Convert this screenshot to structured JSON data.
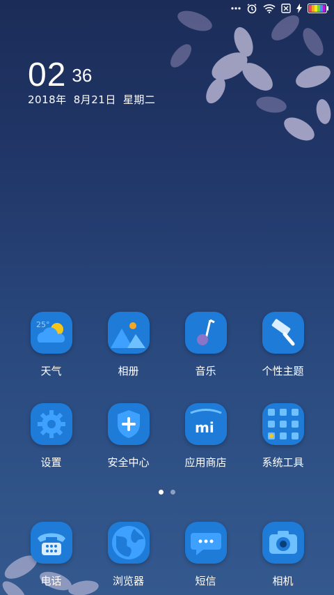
{
  "status_bar": {
    "icons": [
      "more-dots-icon",
      "alarm-icon",
      "wifi-icon",
      "no-sim-icon",
      "charging-icon",
      "battery-icon"
    ]
  },
  "lock_clock": {
    "hour": "02",
    "minute": "36",
    "year": "2018年",
    "day": "8月21日",
    "weekday": "星期二"
  },
  "apps_row1": [
    {
      "label": "天气",
      "icon": "weather-icon"
    },
    {
      "label": "相册",
      "icon": "gallery-icon"
    },
    {
      "label": "音乐",
      "icon": "music-icon"
    },
    {
      "label": "个性主题",
      "icon": "themes-icon"
    }
  ],
  "apps_row2": [
    {
      "label": "设置",
      "icon": "settings-icon"
    },
    {
      "label": "安全中心",
      "icon": "security-icon"
    },
    {
      "label": "应用商店",
      "icon": "app-store-icon"
    },
    {
      "label": "系统工具",
      "icon": "system-tools-folder-icon"
    }
  ],
  "weather_temp": "25°",
  "page_indicator": {
    "pages": 2,
    "active": 1
  },
  "dock": [
    {
      "label": "电话",
      "icon": "phone-icon"
    },
    {
      "label": "浏览器",
      "icon": "browser-icon"
    },
    {
      "label": "短信",
      "icon": "messages-icon"
    },
    {
      "label": "相机",
      "icon": "camera-icon"
    }
  ],
  "colors": {
    "icon_blue": "#1f7bd8",
    "accent_yellow": "#f5c518",
    "accent_purple": "#8a74c8"
  }
}
